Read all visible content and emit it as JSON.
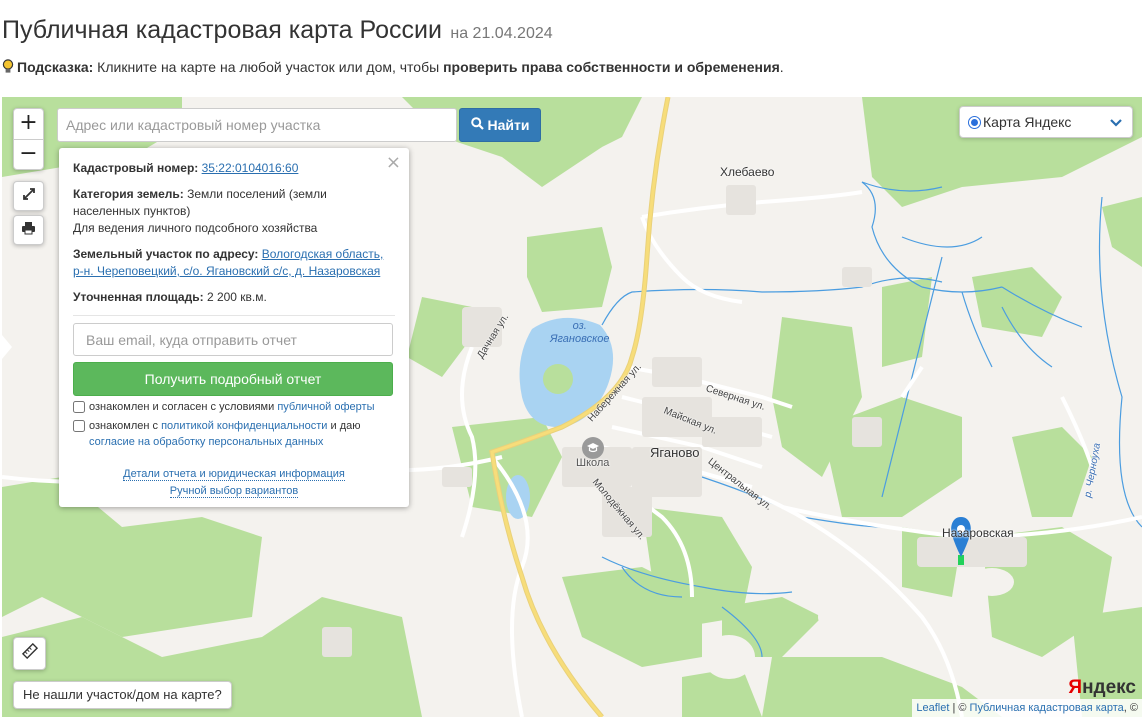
{
  "header": {
    "title": "Публичная кадастровая карта России",
    "date": "на 21.04.2024"
  },
  "hint": {
    "label": "Подсказка:",
    "text": " Кликните на карте на любой участок или дом, чтобы ",
    "bold": "проверить права собственности и обременения",
    "end": "."
  },
  "map": {
    "zoom_in": "+",
    "zoom_out": "−",
    "search_placeholder": "Адрес или кадастровый номер участка",
    "search_button": "Найти",
    "layer_selected": "Карта Яндекс",
    "not_found_button": "Не нашли участок/дом на карте?",
    "yandex_logo": {
      "y": "Я",
      "rest": "ндекс"
    },
    "attribution": {
      "leaflet": "Leaflet",
      "sep": " | © ",
      "source": "Публичная кадастровая карта",
      "tail": ", ©"
    },
    "labels": {
      "khlebaevo": "Хлебаево",
      "yaganovo": "Яганово",
      "nazarovskaya": "Назаровская",
      "school": "Школа",
      "lake_prefix": "оз.",
      "lake_name": "Ягановское",
      "river": "р. Черноуха"
    },
    "streets": {
      "dachnaya": "Дачная ул.",
      "naberezhnaya": "Набережная ул.",
      "severnaya": "Северная ул.",
      "mayskaya": "Майская ул.",
      "tsentralnaya": "Центральная ул.",
      "molodezhnaya": "Молодёжная ул."
    }
  },
  "panel": {
    "close": "×",
    "cadastral_label": "Кадастровый номер:",
    "cadastral_number": "35:22:0104016:60",
    "category_label": "Категория земель:",
    "category_value": "Земли поселений (земли населенных пунктов)",
    "usage": "Для ведения личного подсобного хозяйства",
    "address_label": "Земельный участок по адресу:",
    "address_value": "Вологодская область, р-н. Череповецкий, с/о. Ягановский с/с, д. Назаровская",
    "area_label": "Уточненная площадь:",
    "area_value": "2 200 кв.м.",
    "email_placeholder": "Ваш email, куда отправить отчет",
    "report_button": "Получить подробный отчет",
    "consent1_text": "ознакомлен и согласен с условиями ",
    "consent1_link": "публичной оферты",
    "consent2_text": "ознакомлен с ",
    "consent2_link": "политикой конфиденциальности",
    "consent2_mid": " и даю ",
    "consent2_link2": "согласие на обработку персональных данных",
    "link_details": "Детали отчета и юридическая информация",
    "link_manual": "Ручной выбор вариантов"
  },
  "colors": {
    "forest": "#b8df9c",
    "water": "#a9d3f2",
    "stream": "#4b9de0",
    "road_major": "#f7dd7a",
    "marker": "#2a7fd4",
    "accent_blue": "#337ab7",
    "accent_green": "#5cb85c"
  },
  "icons": [
    "bulb-icon",
    "search-icon",
    "fullscreen-icon",
    "print-icon",
    "ruler-icon",
    "chevron-down-icon",
    "school-icon",
    "map-marker-icon"
  ]
}
